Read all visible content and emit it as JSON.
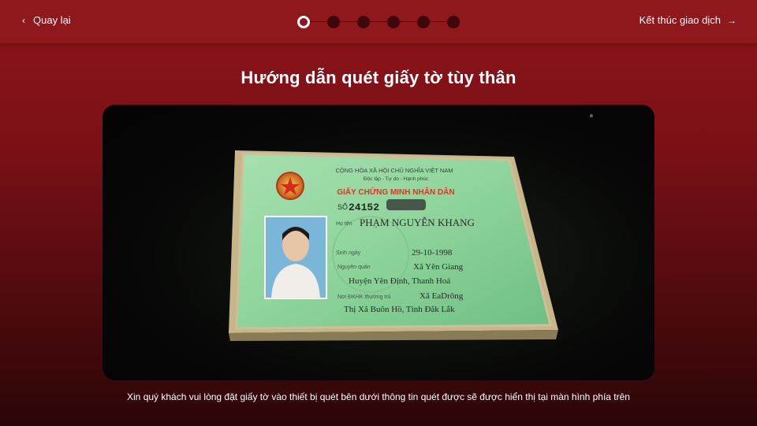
{
  "header": {
    "back_label": "Quay lại",
    "finish_label": "Kết thúc giao dịch",
    "steps_total": 6,
    "active_step": 1
  },
  "main": {
    "title": "Hướng dẫn quét giấy tờ tùy thân",
    "hint": "Xin quý khách vui lòng đặt giấy tờ vào thiết bị quét bên dưới thông tin quét được sẽ được hiển thị tại màn hình phía trên"
  },
  "id_card": {
    "country_line": "CỘNG HÒA XÃ HỘI CHỦ NGHĨA VIỆT NAM",
    "motto": "Độc lập - Tự do - Hạnh phúc",
    "doc_title": "GIẤY CHỨNG MINH NHÂN DÂN",
    "number_label": "SỐ",
    "number": "24152",
    "name_label": "Họ tên",
    "name": "PHẠM NGUYỄN KHANG",
    "dob_label": "Sinh ngày",
    "dob": "29-10-1998",
    "origin_label": "Nguyên quán",
    "origin_1": "Xã Yên Giang",
    "origin_2": "Huyện Yên Định, Thanh Hoá",
    "residence_label": "Nơi ĐKHK thường trú",
    "residence_1": "Xã EaDrông",
    "residence_2": "Thị Xã Buôn Hồ, Tỉnh Đắk Lắk"
  },
  "colors": {
    "header_bg": "#8f181c",
    "step_inactive": "#3e0709",
    "card_green": "#8ed49a",
    "card_red_text": "#d23a2a"
  }
}
